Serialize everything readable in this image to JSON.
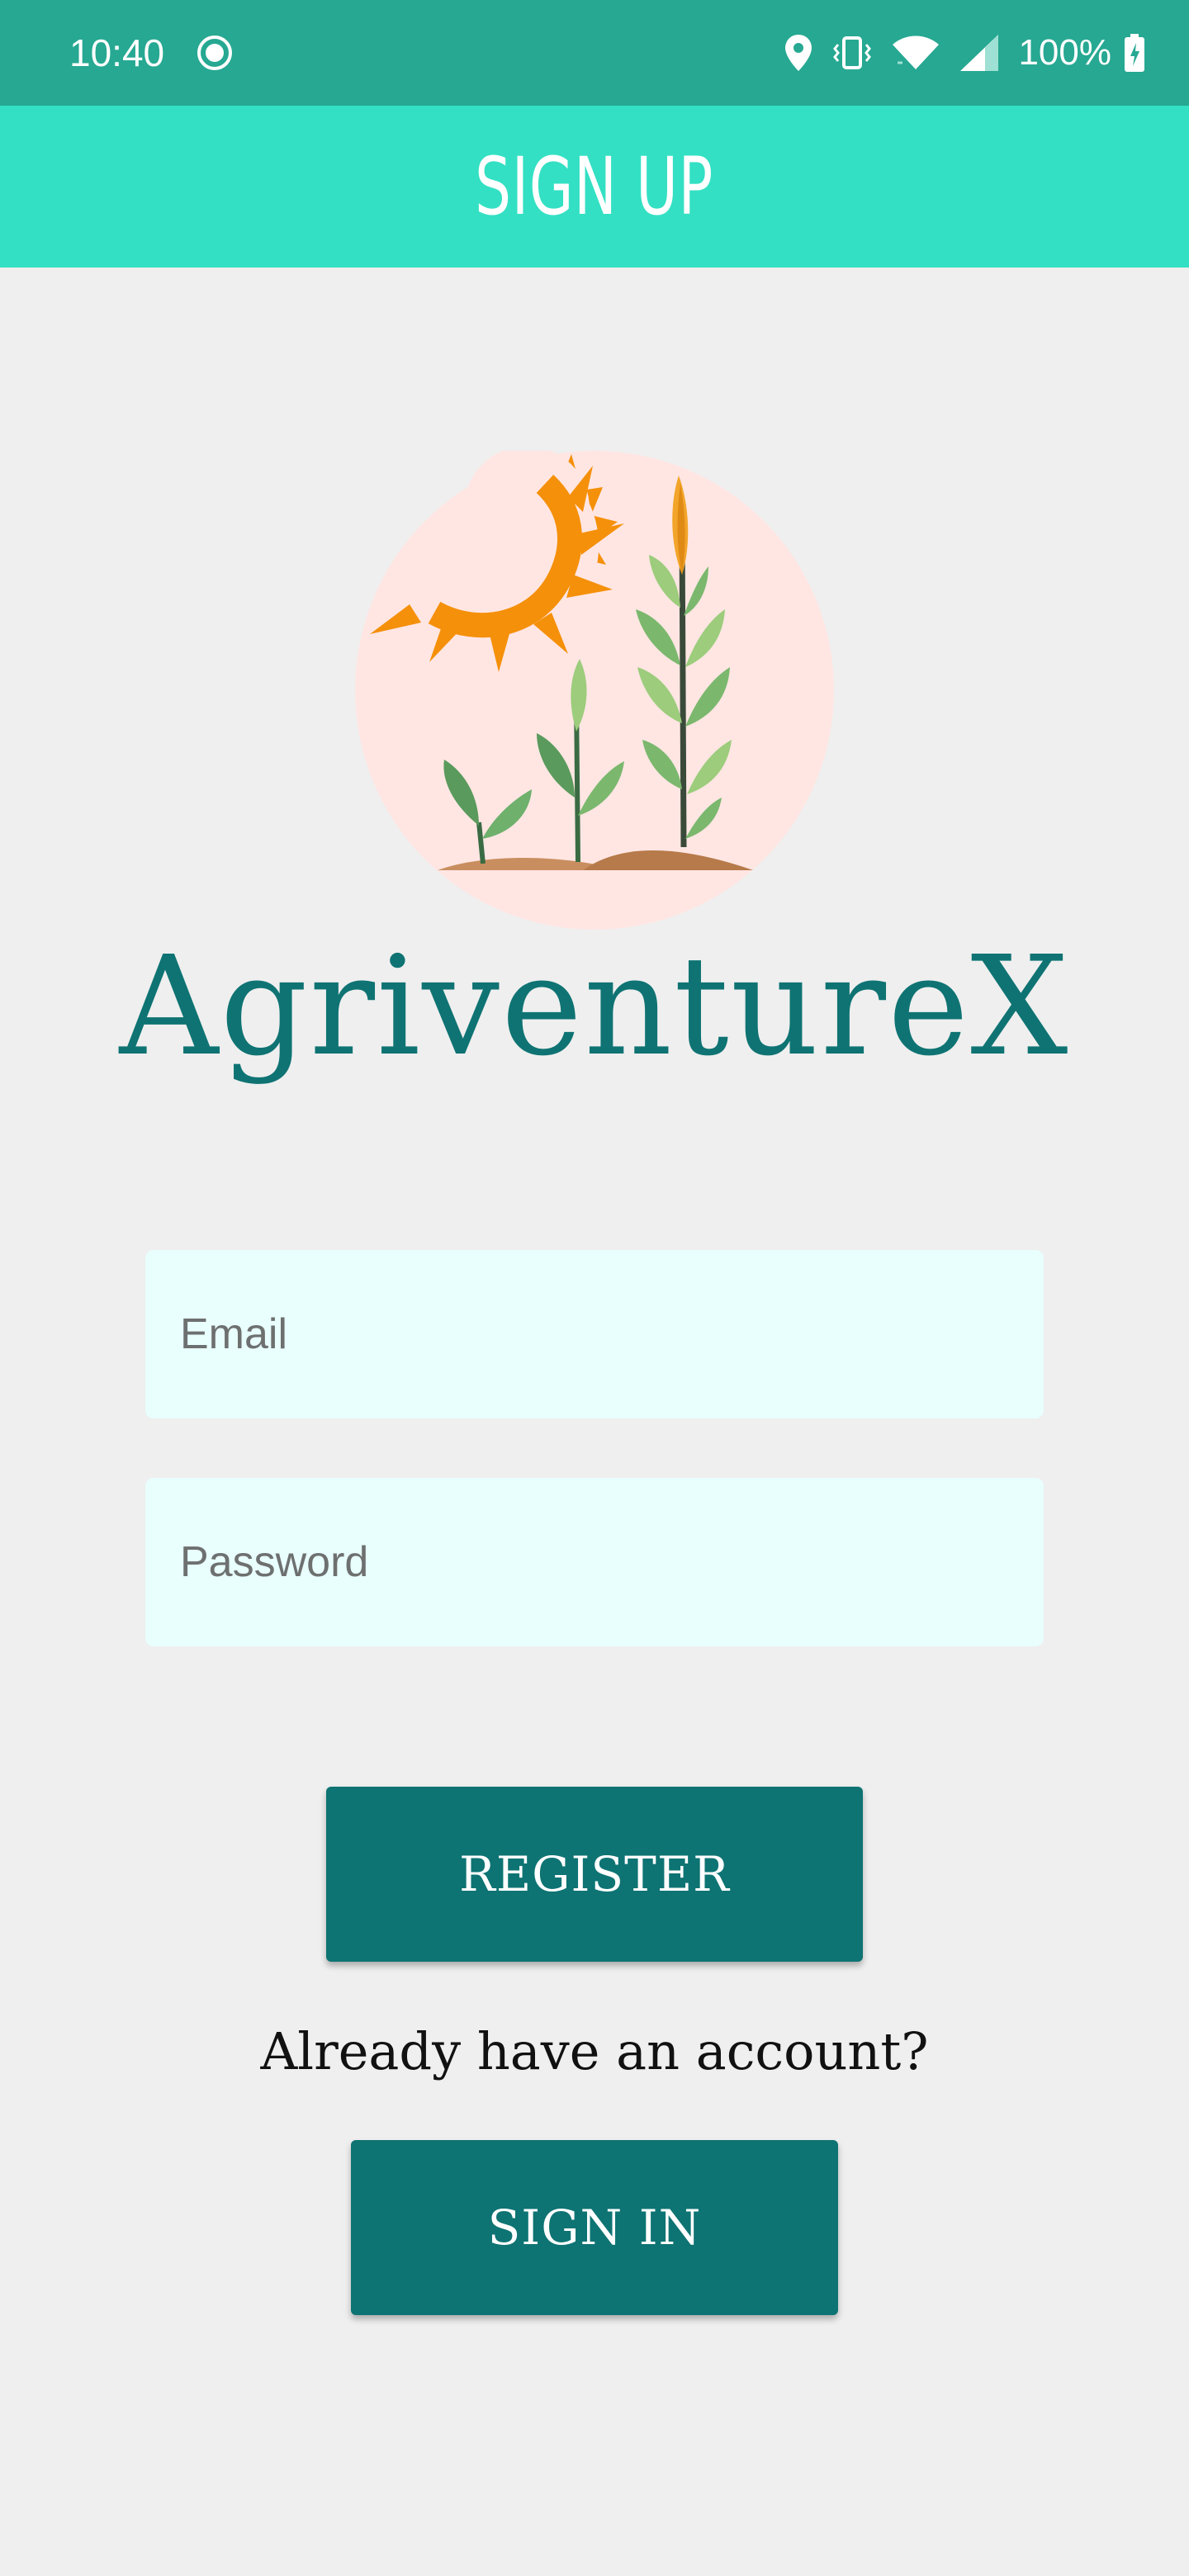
{
  "status_bar": {
    "time": "10:40",
    "battery_percent": "100%",
    "icons": [
      "record-icon",
      "location-icon",
      "vibrate-icon",
      "wifi-icon",
      "signal-icon",
      "battery-charging-icon"
    ]
  },
  "app_bar": {
    "title": "SIGN UP"
  },
  "logo": {
    "brand_name": "AgriventureX",
    "icon": "sun-and-crops-logo"
  },
  "form": {
    "email_placeholder": "Email",
    "password_placeholder": "Password",
    "register_label": "REGISTER",
    "already_text": "Already have an account?",
    "signin_label": "SIGN IN"
  },
  "colors": {
    "status_bar": "#26a892",
    "app_bar": "#33e0c3",
    "primary": "#0e7373",
    "input_bg": "#e8fffd",
    "background": "#efefef",
    "sun": "#f5900a"
  }
}
